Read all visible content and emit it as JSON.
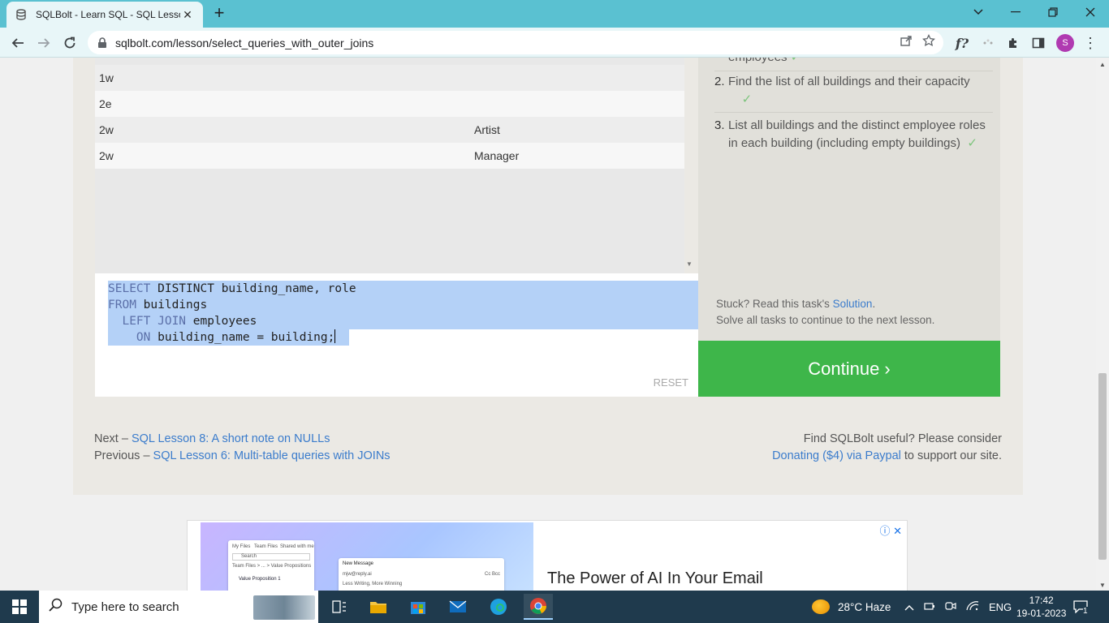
{
  "browser": {
    "tab_title": "SQLBolt - Learn SQL - SQL Lesso",
    "url": "sqlbolt.com/lesson/select_queries_with_outer_joins",
    "avatar_letter": "S"
  },
  "results": {
    "rows": [
      {
        "c1": "1w",
        "c2": ""
      },
      {
        "c1": "2e",
        "c2": ""
      },
      {
        "c1": "2w",
        "c2": "Artist"
      },
      {
        "c1": "2w",
        "c2": "Manager"
      }
    ]
  },
  "editor": {
    "line1_kw": "SELECT",
    "line1_rest": " DISTINCT building_name, role",
    "line2_kw": "FROM",
    "line2_rest": " buildings",
    "line3_kw": "  LEFT JOIN",
    "line3_rest": " employees",
    "line4_kw": "    ON",
    "line4_rest": " building_name = building;",
    "reset_label": "RESET"
  },
  "tasks": {
    "partial_text": "employees",
    "items": [
      {
        "num": "2.",
        "text": "Find the list of all buildings and their capacity"
      },
      {
        "num": "3.",
        "text": "List all buildings and the distinct employee roles in each building (including empty buildings)"
      }
    ],
    "check": "✓",
    "stuck_prefix": "Stuck? Read this task's ",
    "solution_link": "Solution",
    "stuck_suffix": ".",
    "solve_all": "Solve all tasks to continue to the next lesson.",
    "continue_label": "Continue ›"
  },
  "footer": {
    "next_prefix": "Next – ",
    "next_link": "SQL Lesson 8: A short note on NULLs",
    "prev_prefix": "Previous – ",
    "prev_link": "SQL Lesson 6: Multi-table queries with JOINs",
    "donate_line1": "Find SQLBolt useful? Please consider",
    "donate_link": "Donating ($4) via Paypal",
    "donate_suffix": " to support our site."
  },
  "ad": {
    "headline": "The Power of AI In Your Email",
    "mock_tabs": [
      "My Files",
      "Team Files",
      "Shared with me"
    ],
    "mock_search": "Search",
    "mock_breadcrumb": "Team Files  >  ...  >  Value Propositions",
    "mock_file": "Value Proposition 1",
    "mock_msg_title": "New Message",
    "mock_msg_to": "mjw@reply.ai",
    "mock_msg_cc": "Cc Bcc",
    "mock_msg_subject": "Less Writing, More Winning"
  },
  "taskbar": {
    "search_placeholder": "Type here to search",
    "weather": "28°C  Haze",
    "lang": "ENG",
    "time": "17:42",
    "date": "19-01-2023",
    "notif_count": "1"
  }
}
